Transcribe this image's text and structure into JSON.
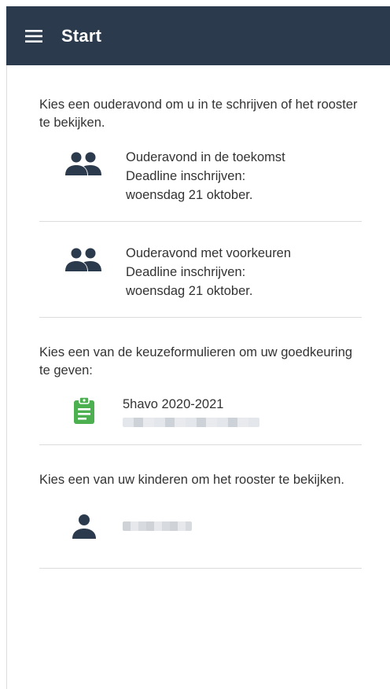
{
  "header": {
    "title": "Start",
    "menu_icon": "hamburger-menu-icon",
    "background": "#2b3a4c"
  },
  "sections": {
    "evenings": {
      "intro": "Kies een ouderavond om u in te schrijven of het rooster te bekijken.",
      "items": [
        {
          "icon": "group-icon",
          "title": "Ouderavond in de toekomst",
          "deadline_label": "Deadline inschrijven:",
          "date": "woensdag 21 oktober."
        },
        {
          "icon": "group-icon",
          "title": "Ouderavond met voorkeuren",
          "deadline_label": "Deadline inschrijven:",
          "date": "woensdag 21 oktober."
        }
      ]
    },
    "forms": {
      "intro": "Kies een van de keuzeformulieren om uw goedkeuring te geven:",
      "items": [
        {
          "icon": "clipboard-icon",
          "icon_color": "#4caf50",
          "title": "5havo 2020-2021"
        }
      ]
    },
    "children": {
      "intro": "Kies een van uw kinderen om het rooster te bekijken.",
      "items": [
        {
          "icon": "person-icon"
        }
      ]
    }
  }
}
